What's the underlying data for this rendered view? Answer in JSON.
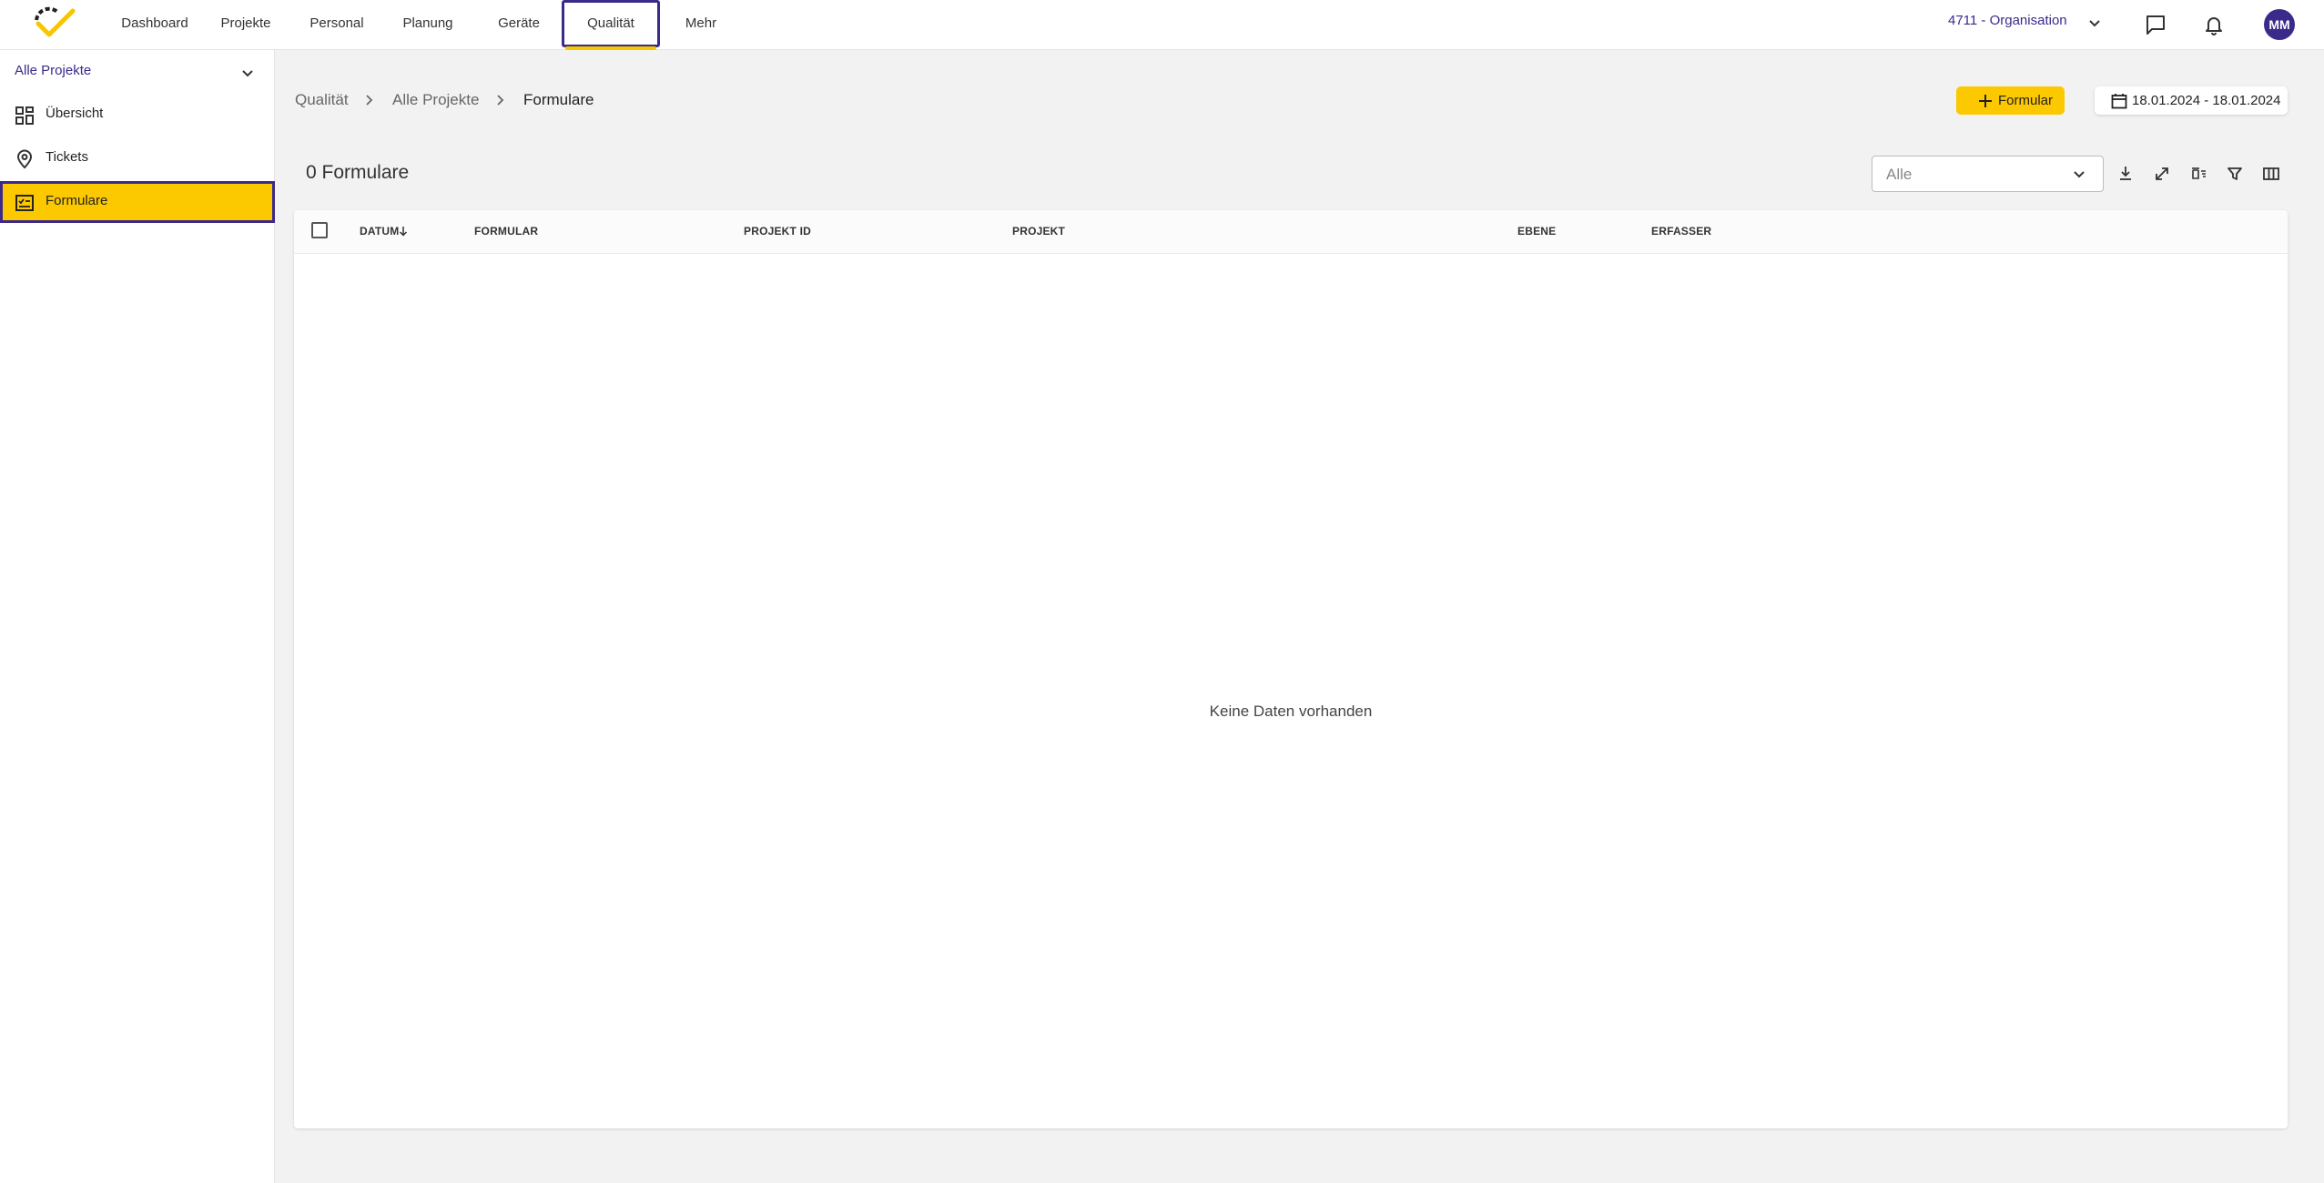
{
  "nav": {
    "items": [
      {
        "label": "Dashboard"
      },
      {
        "label": "Projekte"
      },
      {
        "label": "Personal"
      },
      {
        "label": "Planung"
      },
      {
        "label": "Geräte"
      },
      {
        "label": "Qualität",
        "active": true
      },
      {
        "label": "Mehr"
      }
    ],
    "org_label": "4711 - Organisation",
    "avatar_initials": "MM",
    "accent_color": "#3b2a8a",
    "highlight_color": "#fcc800"
  },
  "sidebar": {
    "project_select": "Alle Projekte",
    "items": [
      {
        "label": "Übersicht",
        "icon": "dashboard-icon"
      },
      {
        "label": "Tickets",
        "icon": "location-pin-icon"
      },
      {
        "label": "Formulare",
        "icon": "form-checklist-icon",
        "active": true
      }
    ]
  },
  "breadcrumb": [
    "Qualität",
    "Alle Projekte",
    "Formulare"
  ],
  "actions": {
    "add_label": "Formular",
    "date_range": "18.01.2024 - 18.01.2024"
  },
  "list": {
    "title": "0 Formulare",
    "filter_value": "Alle",
    "toolbar_icons": [
      "download-icon",
      "expand-icon",
      "clear-filter-icon",
      "filter-icon",
      "columns-icon"
    ]
  },
  "table": {
    "columns": [
      "DATUM",
      "FORMULAR",
      "PROJEKT ID",
      "PROJEKT",
      "EBENE",
      "ERFASSER"
    ],
    "sorted_column": "DATUM",
    "sort_direction": "descending",
    "rows": [],
    "empty_text": "Keine Daten vorhanden"
  }
}
